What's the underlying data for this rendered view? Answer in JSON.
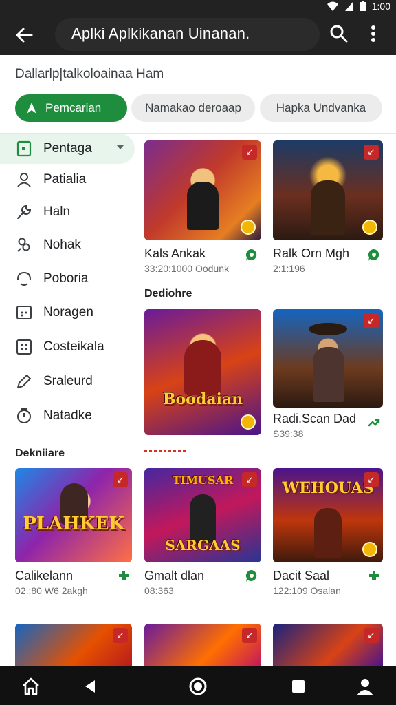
{
  "status_bar": {
    "time": "1:00"
  },
  "app_bar": {
    "title": "Aplki Aplkikanan Uinanan."
  },
  "subtitle": "Dallarlp|talkoloainaa Ham",
  "chips": [
    {
      "label": "Pemcarian",
      "active": true
    },
    {
      "label": "Namakao deroaap",
      "active": false
    },
    {
      "label": "Hapka Undvanka",
      "active": false
    }
  ],
  "sidebar": {
    "items": [
      {
        "label": "Pentaga",
        "icon": "square-icon",
        "active": true
      },
      {
        "label": "Patialia",
        "icon": "person-icon"
      },
      {
        "label": "Haln",
        "icon": "wrench-icon"
      },
      {
        "label": "Nohak",
        "icon": "people-icon"
      },
      {
        "label": "Poboria",
        "icon": "headset-icon"
      },
      {
        "label": "Noragen",
        "icon": "calendar-icon"
      },
      {
        "label": "Costeikala",
        "icon": "grid-icon"
      },
      {
        "label": "Sraleurd",
        "icon": "pen-icon"
      },
      {
        "label": "Natadke",
        "icon": "timer-icon"
      }
    ]
  },
  "sections": {
    "featured_label": "Dediohre",
    "more_label": "Dekniiare"
  },
  "cards": [
    {
      "title": "Kals Ankak",
      "meta": "33:20:1000 Oodunk",
      "action_icon": "chat-icon"
    },
    {
      "title": "Ralk Orn Mgh",
      "meta": "2:1:196",
      "action_icon": "chat-icon"
    },
    {
      "title": "",
      "meta": "",
      "art_text": "Boodaian"
    },
    {
      "title": "Radi.Scan Dad",
      "meta": "S39:38",
      "action_icon": "share-icon"
    },
    {
      "title": "Calikelann",
      "meta": "02.:80 W6 2akgh",
      "action_icon": "puzzle-icon",
      "art_text": "PLAHKEK"
    },
    {
      "title": "Gmalt dlan",
      "meta": "08:363",
      "action_icon": "chat-icon",
      "art_text": "SARGAAS"
    },
    {
      "title": "Dacit Saal",
      "meta": "122:109 Osalan",
      "action_icon": "puzzle-icon",
      "art_text": "WEHOUAS"
    }
  ],
  "colors": {
    "accent": "#1e8e3e",
    "appbar": "#222222",
    "badge": "#c62828"
  }
}
